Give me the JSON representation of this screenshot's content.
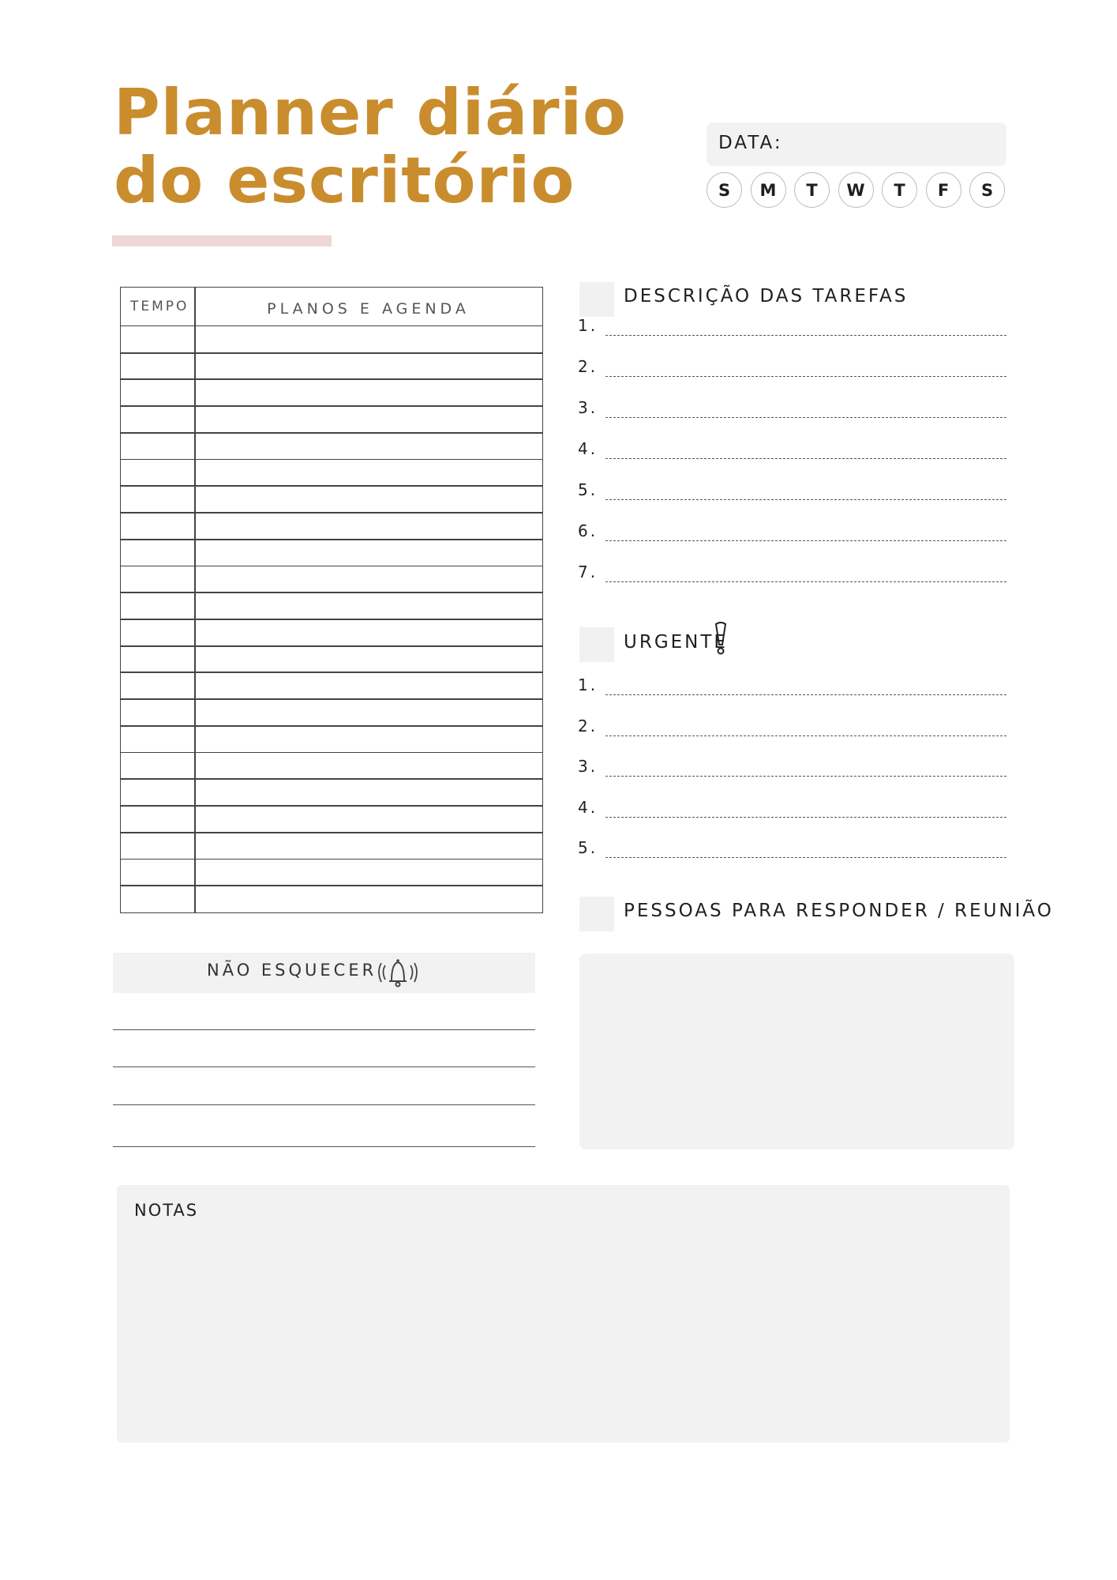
{
  "title": {
    "line1": "Planner diário",
    "line2": "do escritório"
  },
  "date": {
    "label": "DATA:"
  },
  "weekdays": [
    "S",
    "M",
    "T",
    "W",
    "T",
    "F",
    "S"
  ],
  "schedule": {
    "col_time": "TEMPO",
    "col_plans": "PLANOS E AGENDA",
    "rows": 22
  },
  "tasks": {
    "title": "DESCRIÇÃO DAS TAREFAS",
    "numbers": [
      "1.",
      "2.",
      "3.",
      "4.",
      "5.",
      "6.",
      "7."
    ]
  },
  "urgent": {
    "title": "URGENTE",
    "icon": "exclamation-icon",
    "numbers": [
      "1.",
      "2.",
      "3.",
      "4.",
      "5."
    ]
  },
  "people": {
    "title": "PESSOAS PARA RESPONDER / REUNIÃO"
  },
  "dont_forget": {
    "title": "NÃO ESQUECER",
    "icon": "bell-icon",
    "lines": 4
  },
  "notes": {
    "title": "NOTAS"
  },
  "colors": {
    "accent": "#C98D2E",
    "underline": "#EED7D4",
    "panel": "#F2F2F2"
  }
}
